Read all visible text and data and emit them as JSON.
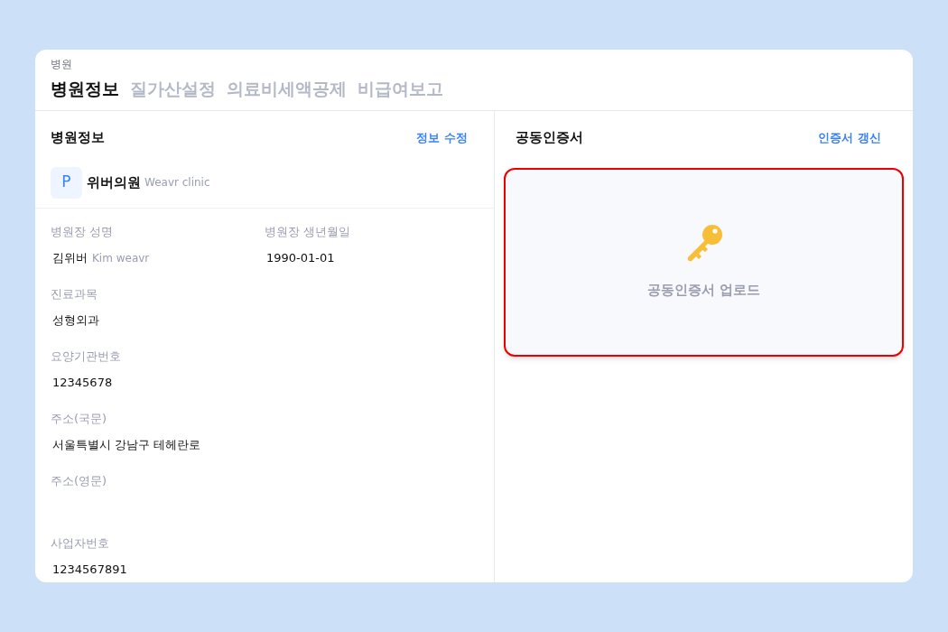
{
  "header": {
    "breadcrumb": "병원",
    "tabs": [
      {
        "label": "병원정보",
        "selected": true
      },
      {
        "label": "질가산설정",
        "selected": false
      },
      {
        "label": "의료비세액공제",
        "selected": false
      },
      {
        "label": "비급여보고",
        "selected": false
      }
    ]
  },
  "hospital_info": {
    "title": "병원정보",
    "action": "정보 수정",
    "logo_letter": "P",
    "name": "위버의원",
    "name_en": "Weavr clinic",
    "field_rows": [
      [
        {
          "label": "병원장 성명",
          "value": "김위버",
          "value_en": "Kim weavr"
        },
        {
          "label": "병원장 생년월일",
          "value": "1990-01-01"
        }
      ],
      [
        {
          "label": "진료과목",
          "value": "성형외과"
        }
      ],
      [
        {
          "label": "요양기관번호",
          "value": "12345678"
        }
      ],
      [
        {
          "label": "주소(국문)",
          "value": "서울특별시 강남구 테헤란로"
        }
      ],
      [
        {
          "label": "주소(영문)"
        }
      ],
      [
        {
          "label": "사업자번호",
          "value": "1234567891"
        }
      ]
    ]
  },
  "certificate": {
    "title": "공동인증서",
    "action": "인증서 갱신",
    "upload_label": "공동인증서 업로드",
    "highlighted": true
  }
}
